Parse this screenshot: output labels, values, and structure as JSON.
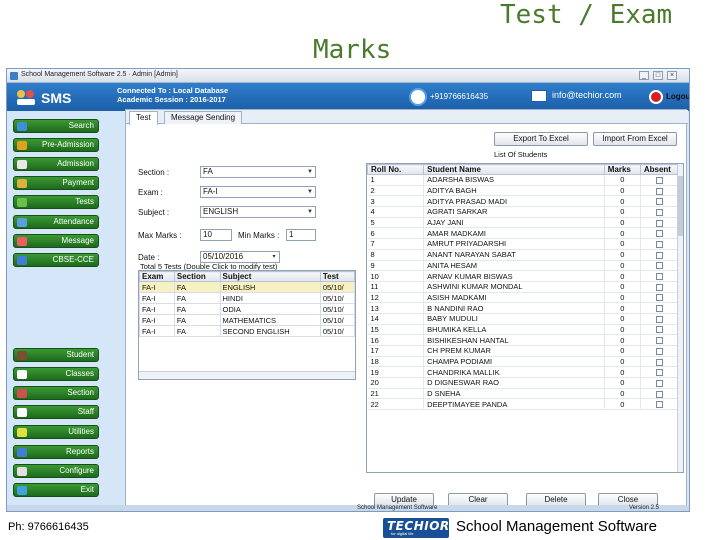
{
  "slide": {
    "title_line1": "Test / Exam",
    "title_line2": "Marks",
    "footer_phone": "Ph: 9766616435",
    "footer_brand": "School Management Software",
    "footer_logo_text": "TECHIOR",
    "footer_logo_tagline": "for digital life"
  },
  "window": {
    "title": "School Management Software 2.5  ·  Admin [Admin]",
    "controls": [
      "_",
      "□",
      "×"
    ]
  },
  "header": {
    "app_name": "SMS",
    "connection_line1": "Connected To : Local Database",
    "connection_line2": "Academic Session : 2016-2017",
    "phone": "+919766616435",
    "email": "info@techior.com",
    "logout": "Logout"
  },
  "sidebar": {
    "top_items": [
      {
        "label": "Search",
        "icon": "search-icon",
        "color": "#3d8fd6"
      },
      {
        "label": "Pre-Admission",
        "icon": "user-add-icon",
        "color": "#e0a020"
      },
      {
        "label": "Admission",
        "icon": "form-icon",
        "color": "#e8e8e8"
      },
      {
        "label": "Payment",
        "icon": "money-icon",
        "color": "#ddb040"
      },
      {
        "label": "Tests",
        "icon": "test-icon",
        "color": "#6ac04a"
      },
      {
        "label": "Attendance",
        "icon": "calendar-icon",
        "color": "#5aa0e0"
      },
      {
        "label": "Message",
        "icon": "message-icon",
        "color": "#e86060"
      },
      {
        "label": "CBSE-CCE",
        "icon": "cbse-icon",
        "color": "#4080d0"
      }
    ],
    "bottom_items": [
      {
        "label": "Student",
        "icon": "student-icon",
        "color": "#7a5030"
      },
      {
        "label": "Classes",
        "icon": "classes-icon",
        "color": "#ffffff"
      },
      {
        "label": "Section",
        "icon": "section-icon",
        "color": "#d05050"
      },
      {
        "label": "Staff",
        "icon": "staff-icon",
        "color": "#ffffff"
      },
      {
        "label": "Utilities",
        "icon": "tools-icon",
        "color": "#e0e040"
      },
      {
        "label": "Reports",
        "icon": "reports-icon",
        "color": "#4080d0"
      },
      {
        "label": "Configure",
        "icon": "gear-icon",
        "color": "#e0e0e0"
      },
      {
        "label": "Exit",
        "icon": "exit-icon",
        "color": "#40a0e0"
      }
    ]
  },
  "tabs": [
    {
      "label": "Test",
      "active": true
    },
    {
      "label": "Message Sending",
      "active": false
    }
  ],
  "toolbar": {
    "export": "Export To Excel",
    "import": "Import From Excel"
  },
  "form": {
    "section_label": "Section :",
    "section_value": "FA",
    "exam_label": "Exam :",
    "exam_value": "FA-I",
    "subject_label": "Subject :",
    "subject_value": "ENGLISH",
    "max_label": "Max Marks :",
    "max_value": "10",
    "min_label": "Min Marks :",
    "min_value": "1",
    "date_label": "Date :",
    "date_value": "05/10/2016"
  },
  "tests": {
    "caption": "Total 5 Tests (Double Click to modify test)",
    "columns": [
      "Exam",
      "Section",
      "Subject",
      "Test"
    ],
    "rows": [
      [
        "FA-I",
        "FA",
        "ENGLISH",
        "05/10/"
      ],
      [
        "FA-I",
        "FA",
        "HINDI",
        "05/10/"
      ],
      [
        "FA-I",
        "FA",
        "ODIA",
        "05/10/"
      ],
      [
        "FA-I",
        "FA",
        "MATHEMATICS",
        "05/10/"
      ],
      [
        "FA-I",
        "FA",
        "SECOND ENGLISH",
        "05/10/"
      ]
    ]
  },
  "students": {
    "caption": "List Of Students",
    "columns": [
      "Roll No.",
      "Student Name",
      "Marks",
      "Absent"
    ],
    "rows": [
      [
        "1",
        "ADARSHA BISWAS",
        "0"
      ],
      [
        "2",
        "ADITYA BAGH",
        "0"
      ],
      [
        "3",
        "ADITYA PRASAD MADI",
        "0"
      ],
      [
        "4",
        "AGRATI SARKAR",
        "0"
      ],
      [
        "5",
        "AJAY JANI",
        "0"
      ],
      [
        "6",
        "AMAR MADKAMI",
        "0"
      ],
      [
        "7",
        "AMRUT PRIYADARSHI",
        "0"
      ],
      [
        "8",
        "ANANT NARAYAN SABAT",
        "0"
      ],
      [
        "9",
        "ANITA HESAM",
        "0"
      ],
      [
        "10",
        "ARNAV KUMAR BISWAS",
        "0"
      ],
      [
        "11",
        "ASHWINI KUMAR MONDAL",
        "0"
      ],
      [
        "12",
        "ASISH MADKAMI",
        "0"
      ],
      [
        "13",
        "B NANDINI RAO",
        "0"
      ],
      [
        "14",
        "BABY MUDULI",
        "0"
      ],
      [
        "15",
        "BHUMIKA KELLA",
        "0"
      ],
      [
        "16",
        "BISHIKESHAN HANTAL",
        "0"
      ],
      [
        "17",
        "CH PREM KUMAR",
        "0"
      ],
      [
        "18",
        "CHAMPA PODIAMI",
        "0"
      ],
      [
        "19",
        "CHANDRIKA MALLIK",
        "0"
      ],
      [
        "20",
        "D DIGNESWAR RAO",
        "0"
      ],
      [
        "21",
        "D SNEHA",
        "0"
      ],
      [
        "22",
        "DEEPTIMAYEE PANDA",
        "0"
      ]
    ]
  },
  "actions": {
    "update": "Update",
    "clear1": "Clear",
    "delete": "Delete",
    "close": "Close"
  },
  "status": {
    "left": "School Management Software",
    "right": "Version 2.5"
  }
}
